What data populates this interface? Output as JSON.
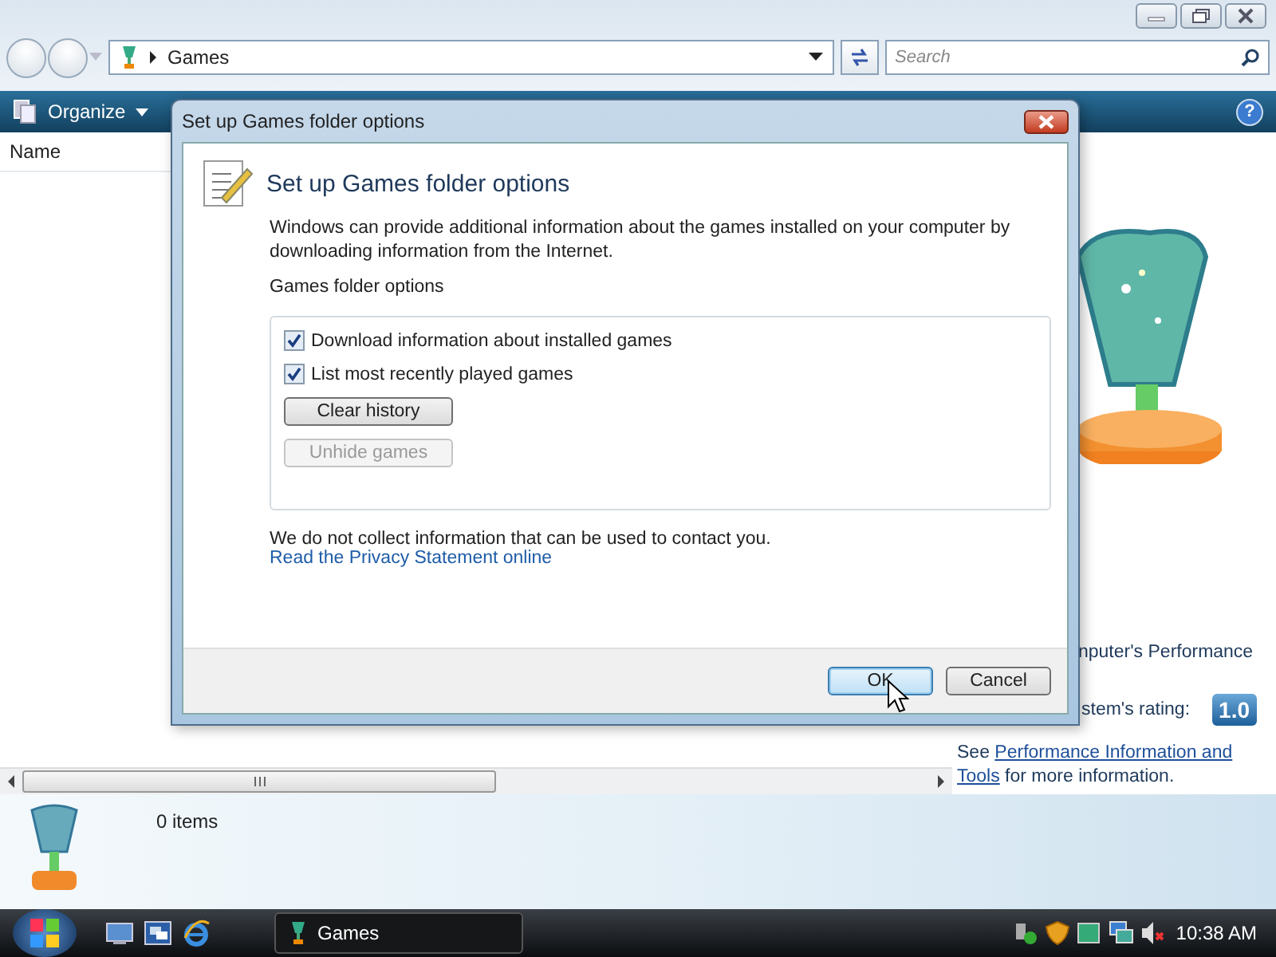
{
  "window": {
    "address": "Games",
    "search": {
      "placeholder": "Search"
    }
  },
  "toolbar": {
    "organize": "Organize",
    "help": "?"
  },
  "file_list": {
    "columns": [
      "Name"
    ]
  },
  "preview_pane": {
    "performance_heading": "nputer's Performance",
    "rating_label": "stem's rating:",
    "rating": "1.0",
    "info_prefix": "See",
    "info_link": [
      "Performance Information and",
      "Tools"
    ],
    "info_suffix": "for more information."
  },
  "details_pane": {
    "item_count": "0 items"
  },
  "dialog": {
    "title": "Set up Games folder options",
    "heading": "Set up Games folder options",
    "description": "Windows can provide additional information about the games installed on your computer by downloading information from the Internet.",
    "group_label": "Games folder options",
    "options": [
      {
        "label": "Download information about installed games",
        "checked": true
      },
      {
        "label": "List most recently played games",
        "checked": true
      }
    ],
    "actions": [
      {
        "label": "Clear history",
        "disabled": false
      },
      {
        "label": "Unhide games",
        "disabled": true
      }
    ],
    "note": "We do not collect information that can be used to contact you.",
    "privacy_link": "Read the Privacy Statement online",
    "buttons": [
      {
        "label": "OK",
        "default": true
      },
      {
        "label": "Cancel",
        "default": false
      }
    ]
  },
  "taskbar": {
    "window_button": "Games",
    "clock": "10:38 AM"
  }
}
